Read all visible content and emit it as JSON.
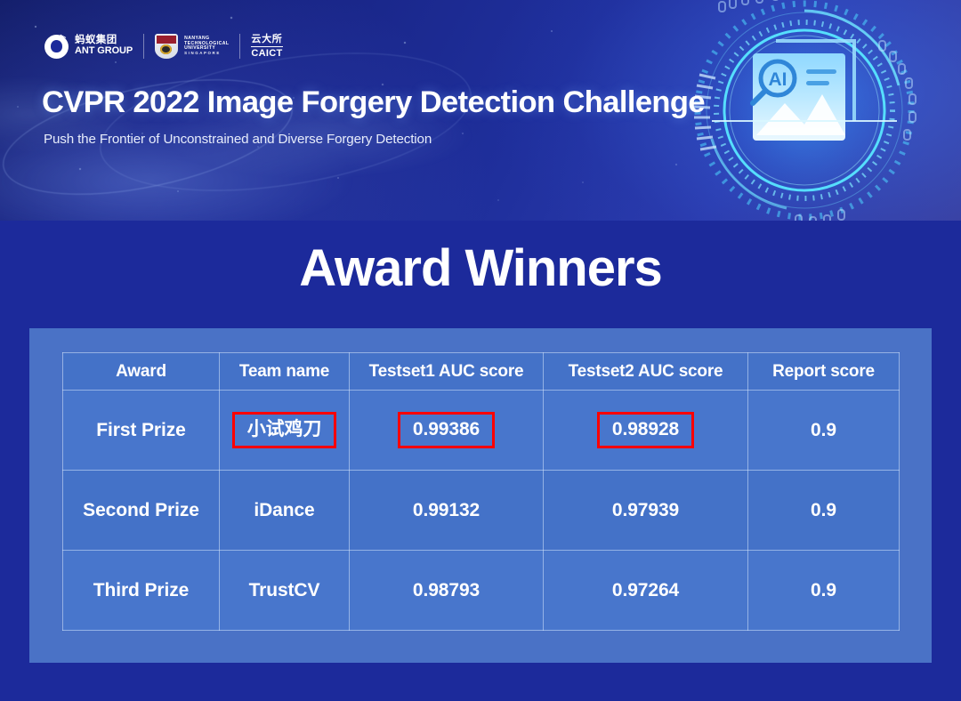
{
  "banner": {
    "title": "CVPR 2022 Image Forgery Detection Challenge",
    "subtitle": "Push the Frontier of Unconstrained and Diverse Forgery Detection",
    "logos": [
      {
        "name": "ant-group",
        "cn": "蚂蚁集团",
        "en": "ANT GROUP"
      },
      {
        "name": "ntu-singapore",
        "line1": "NANYANG",
        "line2": "TECHNOLOGICAL",
        "line3": "UNIVERSITY",
        "line4": "SINGAPORE"
      },
      {
        "name": "caict",
        "cn": "云大所",
        "en": "CAICT"
      }
    ],
    "graphic_label": "AI"
  },
  "page_title": "Award Winners",
  "colors": {
    "background": "#1c2a9b",
    "panel": "#4a72c6",
    "table_cell": "#4472c8",
    "table_cell_alt": "#4876cc",
    "highlight": "#ff0000",
    "text": "#ffffff"
  },
  "table": {
    "headers": [
      "Award",
      "Team name",
      "Testset1 AUC score",
      "Testset2 AUC score",
      "Report score"
    ],
    "rows": [
      {
        "award": "First Prize",
        "team": "小试鸡刀",
        "testset1": "0.99386",
        "testset2": "0.98928",
        "report": "0.9",
        "highlighted": [
          "team",
          "testset1",
          "testset2"
        ]
      },
      {
        "award": "Second Prize",
        "team": "iDance",
        "testset1": "0.99132",
        "testset2": "0.97939",
        "report": "0.9",
        "highlighted": []
      },
      {
        "award": "Third Prize",
        "team": "TrustCV",
        "testset1": "0.98793",
        "testset2": "0.97264",
        "report": "0.9",
        "highlighted": []
      }
    ]
  }
}
